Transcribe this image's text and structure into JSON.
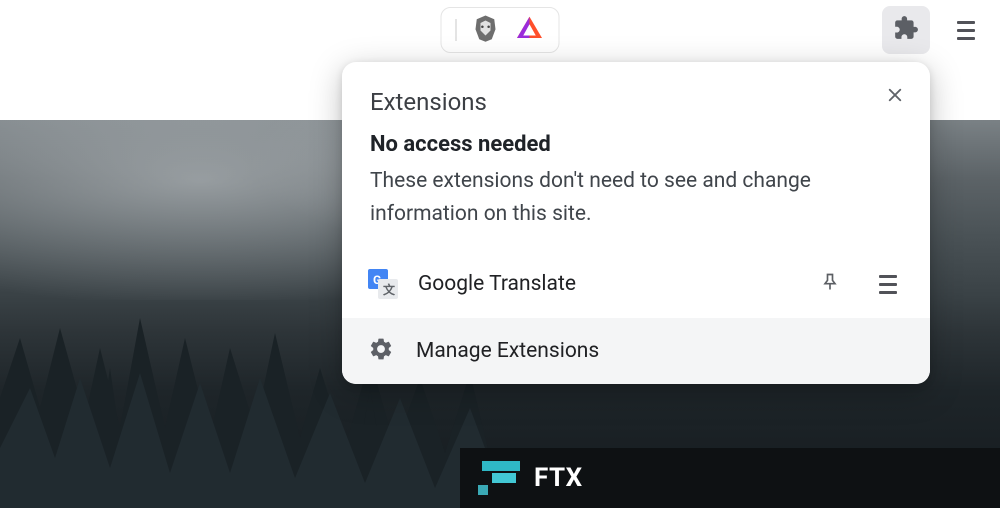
{
  "toolbar": {
    "brave_icon": "brave-lion-icon",
    "bat_icon": "bat-triangle-icon"
  },
  "popup": {
    "title": "Extensions",
    "section": {
      "heading": "No access needed",
      "description": "These extensions don't need to see and change information on this site."
    },
    "items": [
      {
        "name": "Google Translate",
        "icon": "google-translate-icon"
      }
    ],
    "manage_label": "Manage Extensions"
  },
  "page": {
    "ftx_label": "FTX"
  }
}
